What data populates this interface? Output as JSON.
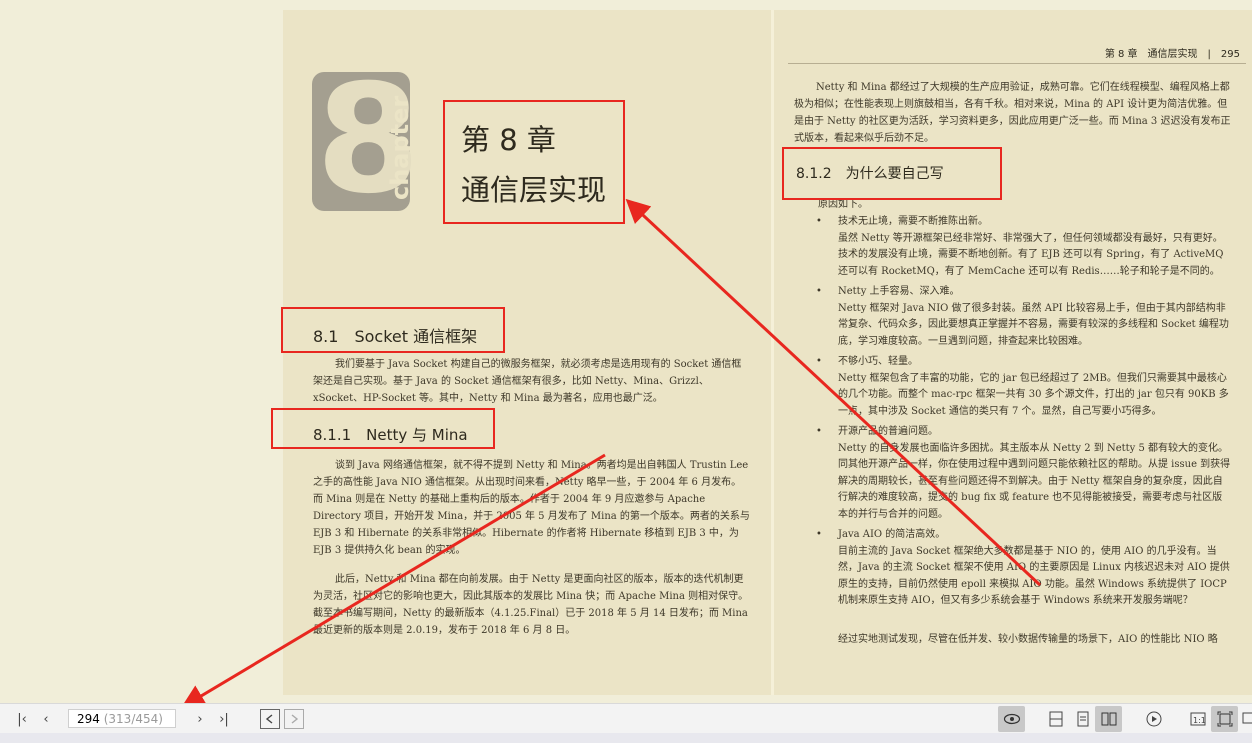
{
  "left_page": {
    "chapter_number": "8",
    "chapter_word": "chapter",
    "chapter_title_line1": "第 8 章",
    "chapter_title_line2": "通信层实现",
    "section_8_1": "8.1　Socket 通信框架",
    "para_8_1": "我们要基于 Java Socket 构建自己的微服务框架，就必须考虑是选用现有的 Socket 通信框架还是自己实现。基于 Java 的 Socket 通信框架有很多，比如 Netty、Mina、Grizzl、xSocket、HP-Socket 等。其中，Netty 和 Mina 最为著名，应用也最广泛。",
    "section_8_1_1": "8.1.1　Netty 与 Mina",
    "para_8_1_1_a": "谈到 Java 网络通信框架，就不得不提到 Netty 和 Mina。两者均是出自韩国人 Trustin Lee 之手的高性能 Java NIO 通信框架。从出现时间来看，Netty 略早一些，于 2004 年 6 月发布。而 Mina 则是在 Netty 的基础上重构后的版本。作者于 2004 年 9 月应邀参与 Apache Directory 项目，开始开发 Mina，并于 2005 年 5 月发布了 Mina 的第一个版本。两者的关系与 EJB 3 和 Hibernate 的关系非常相似。Hibernate 的作者将 Hibernate 移植到 EJB 3 中，为 EJB 3 提供持久化 bean 的实现。",
    "para_8_1_1_b": "此后，Netty 和 Mina 都在向前发展。由于 Netty 是更面向社区的版本，版本的迭代机制更为灵活，社区对它的影响也更大，因此其版本的发展比 Mina 快；而 Apache Mina 则相对保守。截至本书编写期间，Netty 的最新版本（4.1.25.Final）已于 2018 年 5 月 14 日发布；而 Mina 最近更新的版本则是 2.0.19，发布于 2018 年 6 月 8 日。"
  },
  "right_page": {
    "header": "第 8 章　通信层实现　|　295",
    "para_top": "Netty 和 Mina 都经过了大规模的生产应用验证，成熟可靠。它们在线程模型、编程风格上都极为相似；在性能表现上则旗鼓相当，各有千秋。相对来说，Mina 的 API 设计更为简洁优雅。但是由于 Netty 的社区更为活跃，学习资料更多，因此应用更广泛一些。而 Mina 3 迟迟没有发布正式版本，看起来似乎后劲不足。",
    "section_8_1_2": "8.1.2　为什么要自己写",
    "intro": "原因如下。",
    "bullets": [
      {
        "title": "技术无止境，需要不断推陈出新。",
        "body": "虽然 Netty 等开源框架已经非常好、非常强大了，但任何领域都没有最好，只有更好。技术的发展没有止境，需要不断地创新。有了 EJB 还可以有 Spring，有了 ActiveMQ 还可以有 RocketMQ，有了 MemCache 还可以有 Redis……轮子和轮子是不同的。"
      },
      {
        "title": "Netty 上手容易、深入难。",
        "body": "Netty 框架对 Java NIO 做了很多封装。虽然 API 比较容易上手，但由于其内部结构非常复杂、代码众多，因此要想真正掌握并不容易，需要有较深的多线程和 Socket 编程功底，学习难度较高。一旦遇到问题，排查起来比较困难。"
      },
      {
        "title": "不够小巧、轻量。",
        "body": "Netty 框架包含了丰富的功能，它的 jar 包已经超过了 2MB。但我们只需要其中最核心的几个功能。而整个 mac-rpc 框架一共有 30 多个源文件，打出的 jar 包只有 90KB 多一点，其中涉及 Socket 通信的类只有 7 个。显然，自己写要小巧得多。"
      },
      {
        "title": "开源产品的普遍问题。",
        "body": "Netty 的自身发展也面临许多困扰。其主版本从 Netty 2 到 Netty 5 都有较大的变化。同其他开源产品一样，你在使用过程中遇到问题只能依赖社区的帮助。从提 issue 到获得解决的周期较长，甚至有些问题还得不到解决。由于 Netty 框架自身的复杂度，因此自行解决的难度较高，提交的 bug fix 或 feature 也不见得能被接受，需要考虑与社区版本的并行与合并的问题。"
      },
      {
        "title": "Java AIO 的简洁高效。",
        "body": "目前主流的 Java Socket 框架绝大多数都是基于 NIO 的，使用 AIO 的几乎没有。当然，Java 的主流 Socket 框架不使用 AIO 的主要原因是 Linux 内核迟迟未对 AIO 提供原生的支持，目前仍然使用 epoll 来模拟 AIO 功能。虽然 Windows 系统提供了 IOCP 机制来原生支持 AIO，但又有多少系统会基于 Windows 系统来开发服务端呢？"
      }
    ],
    "para_last": "经过实地测试发现，尽管在低并发、较小数据传输量的场景下，AIO 的性能比 NIO 略"
  },
  "toolbar": {
    "first_icon": "⟨|",
    "page_current": "294",
    "page_sub": "(313/454)"
  },
  "colors": {
    "annotation": "#e8271f",
    "page_bg": "#ebe4c6",
    "canvas_bg": "#f1eed9"
  }
}
